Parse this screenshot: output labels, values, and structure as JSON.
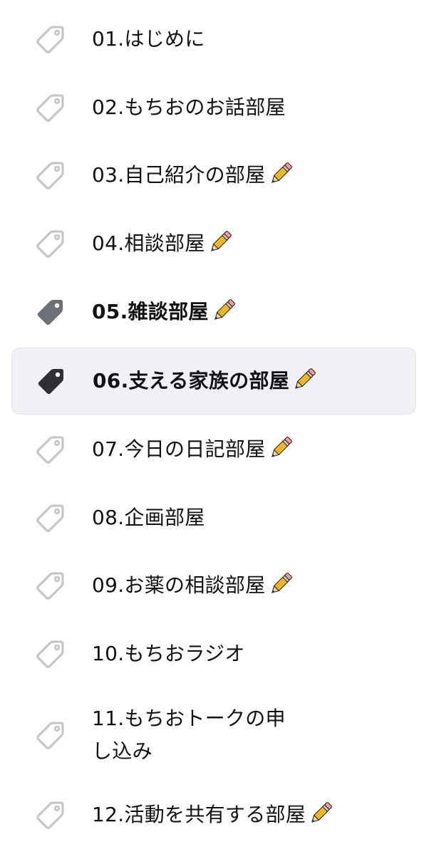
{
  "channels": [
    {
      "label": "01.はじめに",
      "pencil": false,
      "bold": false,
      "selected": false,
      "icon": "tag-outline-icon"
    },
    {
      "label": "02.もちおのお話部屋",
      "pencil": false,
      "bold": false,
      "selected": false,
      "icon": "tag-outline-icon"
    },
    {
      "label": "03.自己紹介の部屋",
      "pencil": true,
      "bold": false,
      "selected": false,
      "icon": "tag-outline-icon"
    },
    {
      "label": "04.相談部屋",
      "pencil": true,
      "bold": false,
      "selected": false,
      "icon": "tag-outline-icon"
    },
    {
      "label": "05.雑談部屋",
      "pencil": true,
      "bold": true,
      "selected": false,
      "icon": "tag-filled-icon"
    },
    {
      "label": "06.支える家族の部屋",
      "pencil": true,
      "bold": true,
      "selected": true,
      "icon": "tag-filled-icon"
    },
    {
      "label": "07.今日の日記部屋",
      "pencil": true,
      "bold": false,
      "selected": false,
      "icon": "tag-outline-icon"
    },
    {
      "label": "08.企画部屋",
      "pencil": false,
      "bold": false,
      "selected": false,
      "icon": "tag-outline-icon"
    },
    {
      "label": "09.お薬の相談部屋",
      "pencil": true,
      "bold": false,
      "selected": false,
      "icon": "tag-outline-icon"
    },
    {
      "label": "10.もちおラジオ",
      "pencil": false,
      "bold": false,
      "selected": false,
      "icon": "tag-outline-icon"
    },
    {
      "label": "11.もちおトークの申し込み",
      "pencil": false,
      "bold": false,
      "selected": false,
      "icon": "tag-outline-icon"
    },
    {
      "label": "12.活動を共有する部屋",
      "pencil": true,
      "bold": false,
      "selected": false,
      "icon": "tag-outline-icon"
    }
  ],
  "colors": {
    "text": "#111114",
    "tag_outline": "#c4c6cc",
    "tag_filled_unread": "#6e7078",
    "tag_filled_selected": "#2f3035",
    "selected_bg": "#f0f1f4"
  }
}
